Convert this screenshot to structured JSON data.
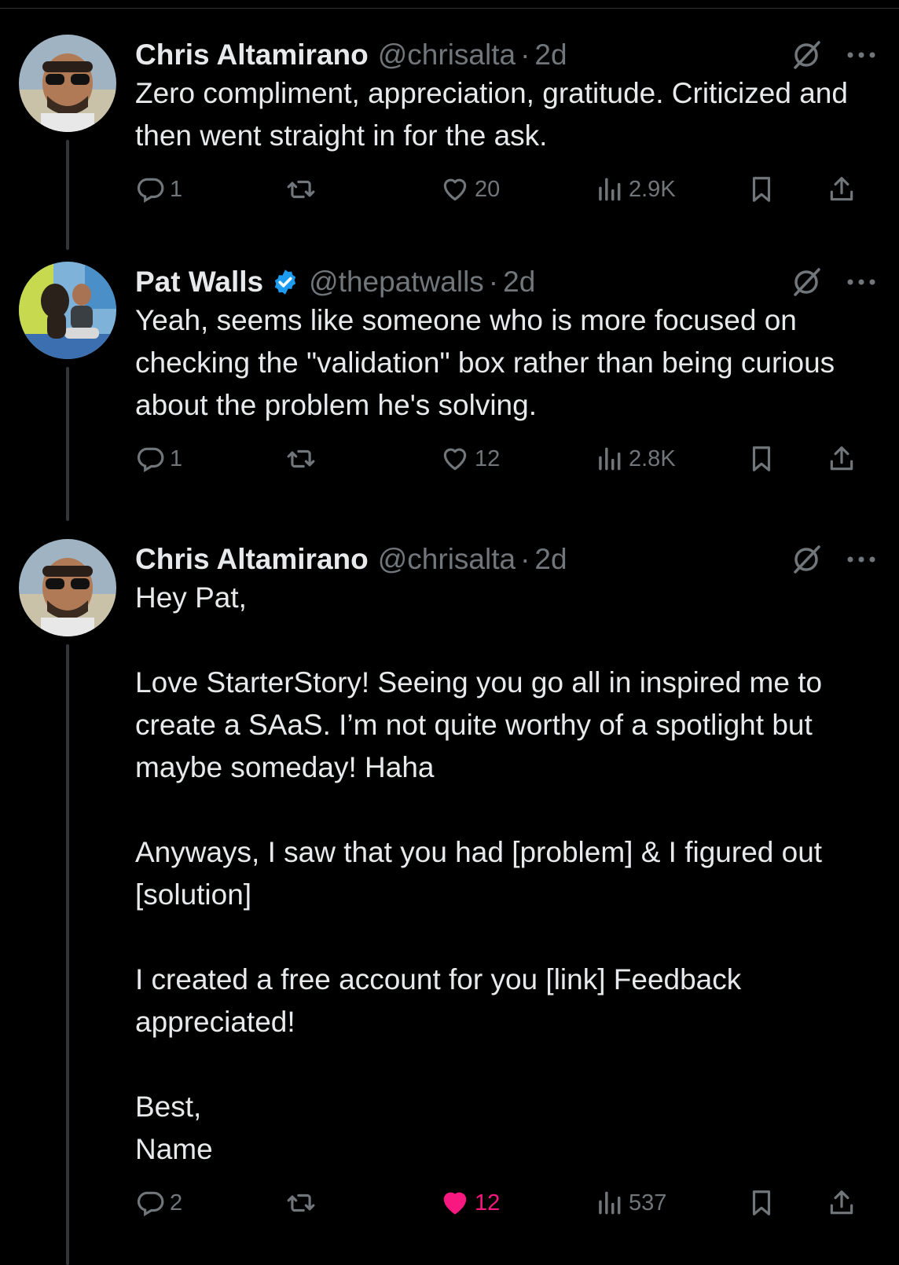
{
  "tweets": [
    {
      "name": "Chris Altamirano",
      "handle": "@chrisalta",
      "time": "2d",
      "verified": false,
      "text": "Zero compliment, appreciation, gratitude. Criticized and then went straight in for the ask.",
      "replies": "1",
      "likes": "20",
      "views": "2.9K"
    },
    {
      "name": "Pat Walls",
      "handle": "@thepatwalls",
      "time": "2d",
      "verified": true,
      "text": "Yeah, seems like someone who is more focused on checking the \"validation\" box rather than being curious about the problem he's solving.",
      "replies": "1",
      "likes": "12",
      "views": "2.8K"
    },
    {
      "name": "Chris Altamirano",
      "handle": "@chrisalta",
      "time": "2d",
      "verified": false,
      "text": "Hey Pat,\n\nLove StarterStory! Seeing you go all in inspired me to create a SAaS. I’m not quite worthy of a spotlight but maybe someday! Haha\n\nAnyways, I saw that you had [problem] & I figured out [solution]\n\nI created a free account for you [link] Feedback appreciated!\n\nBest,\nName",
      "replies": "2",
      "likes": "12",
      "views": "537",
      "liked": true
    }
  ],
  "colors": {
    "background": "#000000",
    "text": "#e7e9ea",
    "muted": "#71767b",
    "verified": "#1d9bf0",
    "like_active": "#f91880"
  },
  "icons": [
    "reply-icon",
    "repost-icon",
    "like-icon",
    "views-icon",
    "bookmark-icon",
    "share-icon",
    "grok-icon",
    "more-icon",
    "verified-badge-icon"
  ]
}
